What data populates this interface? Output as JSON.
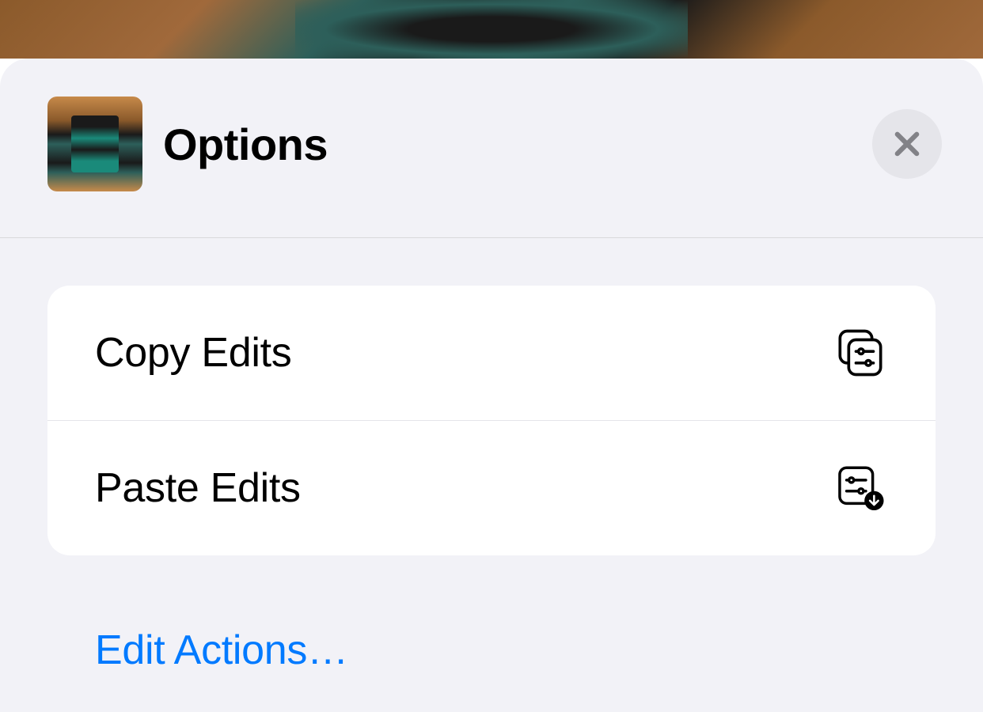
{
  "sheet": {
    "title": "Options",
    "actions": [
      {
        "label": "Copy Edits"
      },
      {
        "label": "Paste Edits"
      }
    ],
    "edit_actions_label": "Edit Actions…"
  }
}
